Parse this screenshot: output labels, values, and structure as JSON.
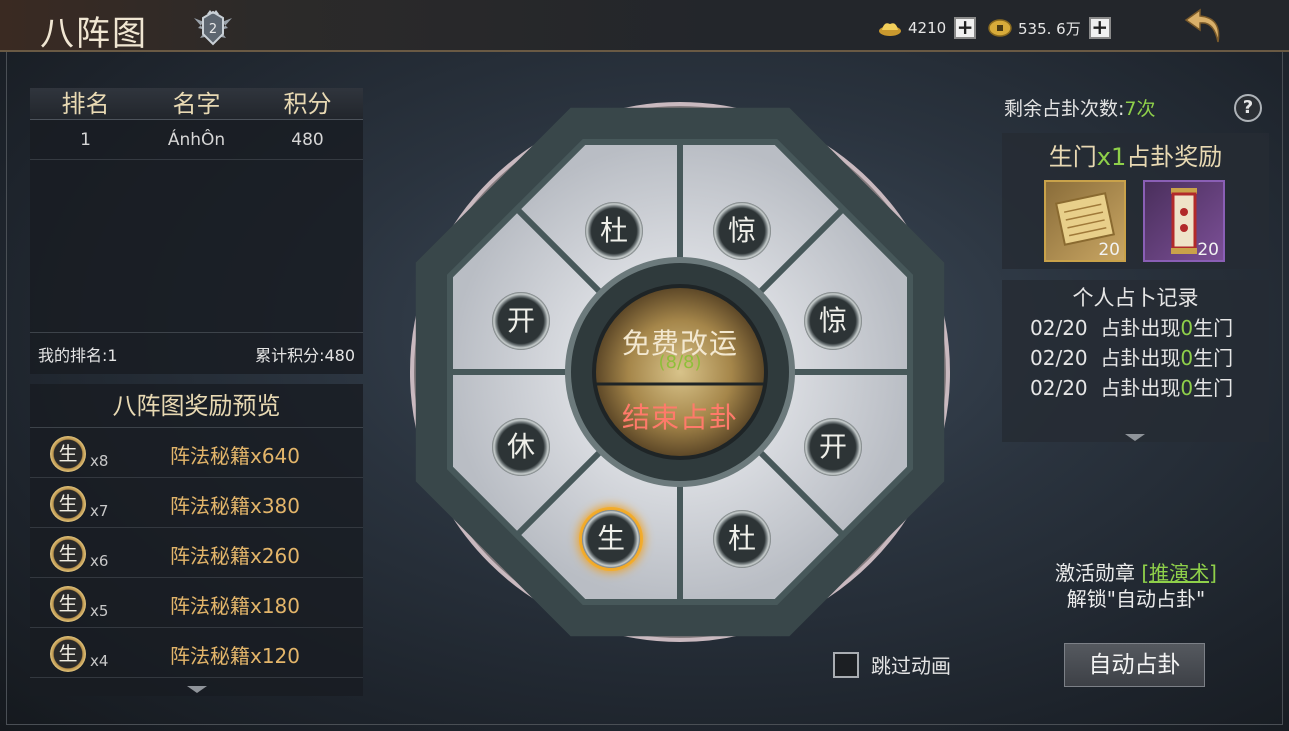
{
  "header": {
    "title": "八阵图",
    "rank_badge_level": "2",
    "gold_amount": "4210",
    "coin_amount": "535. 6万",
    "icons": {
      "gold": "gold-ingot-icon",
      "coin": "copper-coin-icon",
      "plus": "plus-icon",
      "back": "back-arrow-icon"
    }
  },
  "ranking": {
    "columns": [
      "排名",
      "名字",
      "积分"
    ],
    "rows": [
      {
        "rank": "1",
        "name": "ÁnhÔn",
        "score": "480"
      }
    ],
    "my_rank": "我的排名:1",
    "total_score": "累计积分:480"
  },
  "rewards_preview": {
    "title": "八阵图奖励预览",
    "coin_label": "生",
    "items": [
      {
        "mult": "x8",
        "text": "阵法秘籍x640"
      },
      {
        "mult": "x7",
        "text": "阵法秘籍x380"
      },
      {
        "mult": "x6",
        "text": "阵法秘籍x260"
      },
      {
        "mult": "x5",
        "text": "阵法秘籍x180"
      },
      {
        "mult": "x4",
        "text": "阵法秘籍x120"
      }
    ]
  },
  "wheel": {
    "nodes": [
      "杜",
      "惊",
      "惊",
      "开",
      "杜",
      "生",
      "休",
      "开"
    ],
    "active_node": "生",
    "center_free": "免费改运",
    "center_count": "(8/8)",
    "center_end": "结束占卦"
  },
  "side": {
    "remaining_label": "剩余占卦次数:",
    "remaining_count": "7次",
    "help": "?",
    "gate_title_pre": "生门",
    "gate_title_mult": "x1",
    "gate_title_post": "占卦奖励",
    "gate_items": [
      {
        "name": "scroll-item-icon",
        "count": "20"
      },
      {
        "name": "luck-talisman-item-icon",
        "count": "20"
      }
    ],
    "log_title": "个人占卜记录",
    "log_rows": [
      {
        "date": "02/20",
        "pre": "占卦出现",
        "n": "0",
        "post": "生门"
      },
      {
        "date": "02/20",
        "pre": "占卦出现",
        "n": "0",
        "post": "生门"
      },
      {
        "date": "02/20",
        "pre": "占卦出现",
        "n": "0",
        "post": "生门"
      }
    ],
    "unlock_line1_pre": "激活勋章",
    "unlock_link": "[推演术]",
    "unlock_line2": "解锁\"自动占卦\"",
    "skip_label": "跳过动画",
    "auto_button": "自动占卦"
  },
  "colors": {
    "accent_green": "#8fd04a",
    "gold_text": "#e3b56a",
    "red_text": "#ff7a6a"
  }
}
